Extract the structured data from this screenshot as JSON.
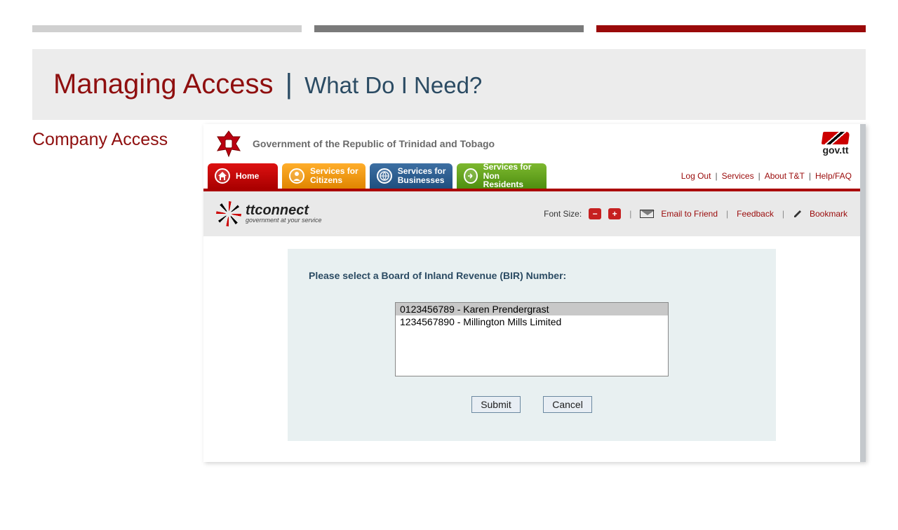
{
  "hero": {
    "title_red": "Managing Access",
    "separator": "|",
    "title_blue": "What Do I Need?"
  },
  "leftcol": {
    "title": "Company Access"
  },
  "gov": {
    "title": "Government of the Republic of Trinidad and Tobago",
    "logo_label": "gov.tt"
  },
  "nav": {
    "home": "Home",
    "citizens": "Services for\nCitizens",
    "business": "Services for\nBusinesses",
    "nonres": "Services for Non\nResidents",
    "right_logout": "Log Out",
    "right_services": "Services",
    "right_about": "About T&T",
    "right_help": "Help/FAQ"
  },
  "brand": {
    "name": "ttconnect",
    "tagline": "government at your service"
  },
  "subheader": {
    "font_label": "Font Size:",
    "email": "Email to Friend",
    "feedback": "Feedback",
    "bookmark": "Bookmark"
  },
  "form": {
    "heading": "Please select a Board of Inland Revenue (BIR) Number:",
    "options": [
      "0123456789 - Karen Prendergrast",
      "1234567890 - Millington Mills Limited"
    ],
    "submit": "Submit",
    "cancel": "Cancel"
  }
}
